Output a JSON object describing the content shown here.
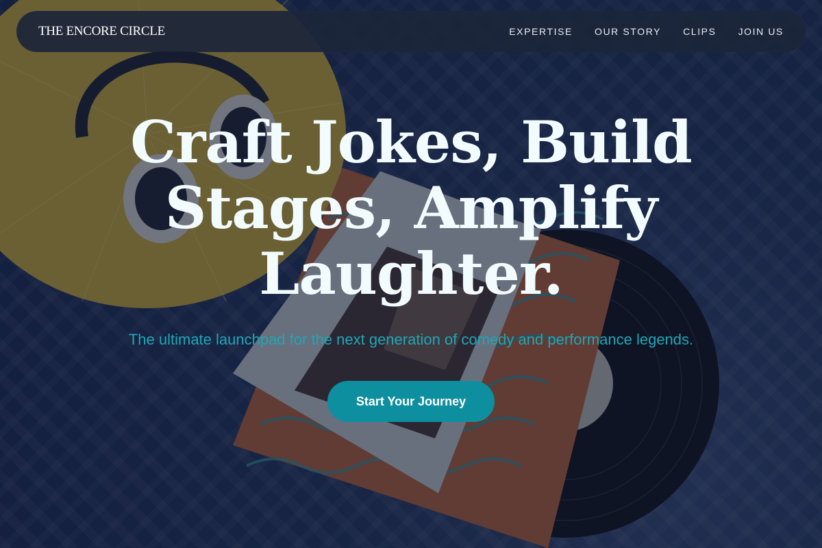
{
  "nav": {
    "logo": "THE ENCORE CIRCLE",
    "links": [
      "EXPERTISE",
      "OUR STORY",
      "CLIPS",
      "JOIN US"
    ]
  },
  "hero": {
    "title": "Craft Jokes, Build Stages, Amplify Laughter.",
    "subtitle": "The ultimate launchpad for the next generation of comedy and performance legends.",
    "cta_label": "Start Your Journey"
  },
  "background": {
    "image": "headphones-and-vinyl-record-photo",
    "overlay_color": "#0e1830"
  },
  "colors": {
    "accent": "#0e8fa0",
    "subtitle": "#1fa7b6",
    "title": "#f2fbfd",
    "navbar": "#1c263a"
  }
}
